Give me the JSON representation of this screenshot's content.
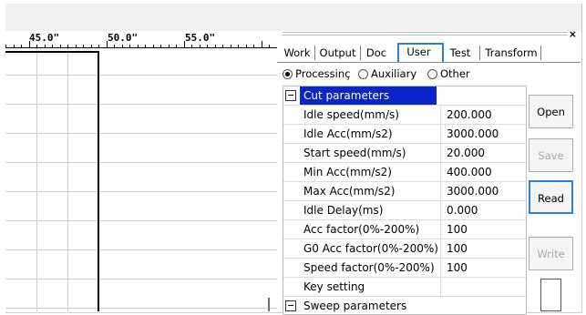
{
  "ruler": {
    "labels": [
      "45.0\"",
      "50.0\"",
      "55.0\""
    ]
  },
  "panel": {
    "close_symbol": "×",
    "tabs": [
      {
        "label": "Work"
      },
      {
        "label": "Output"
      },
      {
        "label": "Doc"
      },
      {
        "label": "User"
      },
      {
        "label": "Test"
      },
      {
        "label": "Transform"
      }
    ],
    "active_tab": "User",
    "radios": [
      {
        "label": "Processinç",
        "checked": true
      },
      {
        "label": "Auxiliary",
        "checked": false
      },
      {
        "label": "Other",
        "checked": false
      }
    ],
    "section_cut": "Cut parameters",
    "params": [
      {
        "name": "Idle speed(mm/s)",
        "value": "200.000"
      },
      {
        "name": "Idle Acc(mm/s2)",
        "value": "3000.000"
      },
      {
        "name": "Start speed(mm/s)",
        "value": "20.000"
      },
      {
        "name": "Min Acc(mm/s2)",
        "value": "400.000"
      },
      {
        "name": "Max Acc(mm/s2)",
        "value": "3000.000"
      },
      {
        "name": "Idle Delay(ms)",
        "value": "0.000"
      },
      {
        "name": "Acc factor(0%-200%)",
        "value": "100"
      },
      {
        "name": "G0 Acc factor(0%-200%)",
        "value": "100"
      },
      {
        "name": "Speed factor(0%-200%)",
        "value": "100"
      },
      {
        "name": "Key setting",
        "value": ""
      }
    ],
    "section_sweep": "Sweep parameters",
    "buttons": {
      "open": "Open",
      "save": "Save",
      "read": "Read",
      "write": "Write"
    }
  },
  "colors": {
    "selection": "#0a24c9",
    "focus": "#2c7fd3"
  }
}
